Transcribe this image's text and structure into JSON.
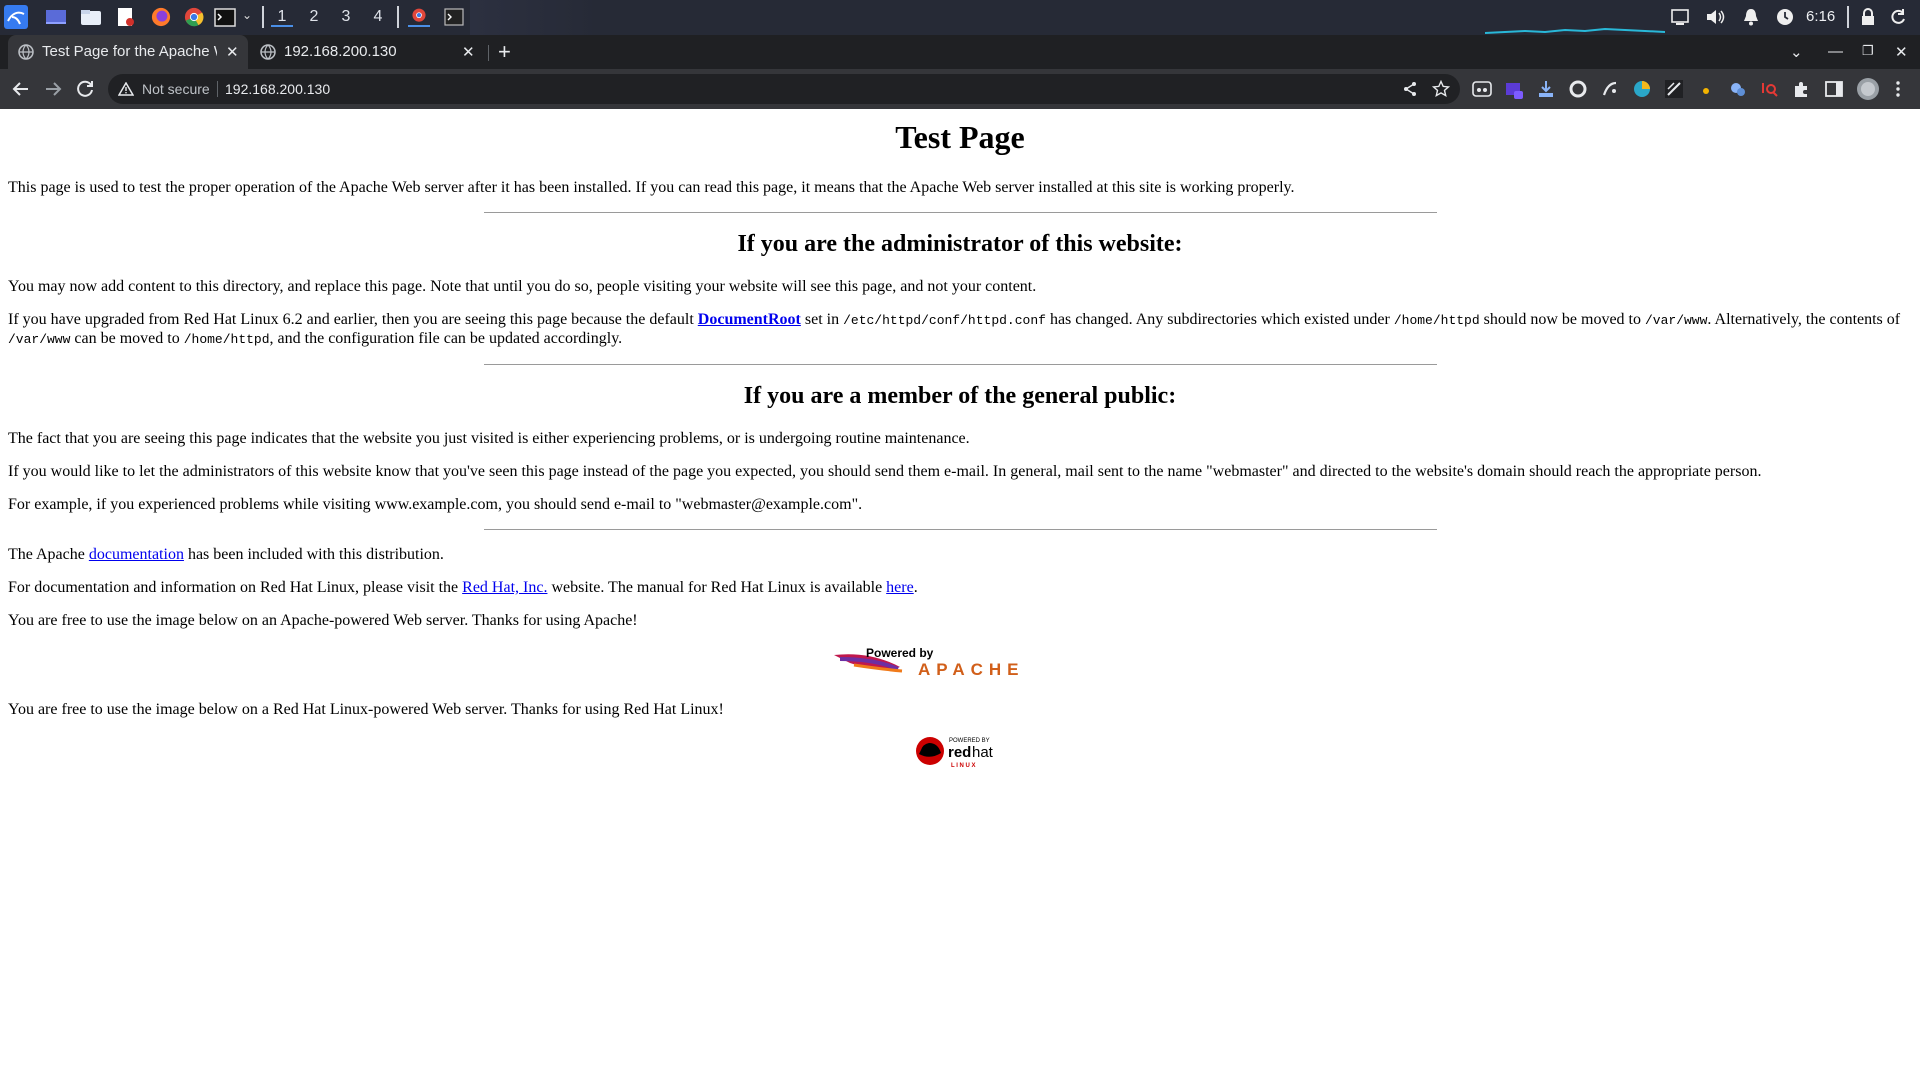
{
  "os_panel": {
    "workspaces": [
      "1",
      "2",
      "3",
      "4"
    ],
    "time": "6:16",
    "launchers": [
      "kali-menu-icon",
      "desktop-icon",
      "file-manager-icon",
      "text-editor-icon",
      "firefox-icon",
      "chrome-icon",
      "terminal-icon"
    ]
  },
  "browser": {
    "tabs": [
      {
        "title": "Test Page for the Apache W",
        "active": true
      },
      {
        "title": "192.168.200.130",
        "active": false
      }
    ],
    "omnibox": {
      "security_label": "Not secure",
      "url": "192.168.200.130"
    }
  },
  "page": {
    "title": "Test Page",
    "intro": "This page is used to test the proper operation of the Apache Web server after it has been installed. If you can read this page, it means that the Apache Web server installed at this site is working properly.",
    "admin_heading": "If you are the administrator of this website:",
    "admin_p1": "You may now add content to this directory, and replace this page. Note that until you do so, people visiting your website will see this page, and not your content.",
    "admin_p2": {
      "t1": "If you have upgraded from Red Hat Linux 6.2 and earlier, then you are seeing this page because the default ",
      "link_documentroot": "DocumentRoot",
      "t2": " set in ",
      "code_httpd_conf": "/etc/httpd/conf/httpd.conf",
      "t3": " has changed. Any subdirectories which existed under ",
      "code_home_httpd": "/home/httpd",
      "t4": " should now be moved to ",
      "code_var_www": "/var/www",
      "t5": ". Alternatively, the contents of ",
      "code_var_www_2": "/var/www",
      "t6": " can be moved to ",
      "code_home_httpd_2": "/home/httpd",
      "t7": ", and the configuration file can be updated accordingly."
    },
    "public_heading": "If you are a member of the general public:",
    "public_p1": "The fact that you are seeing this page indicates that the website you just visited is either experiencing problems, or is undergoing routine maintenance.",
    "public_p2": "If you would like to let the administrators of this website know that you've seen this page instead of the page you expected, you should send them e-mail. In general, mail sent to the name \"webmaster\" and directed to the website's domain should reach the appropriate person.",
    "public_p3": "For example, if you experienced problems while visiting www.example.com, you should send e-mail to \"webmaster@example.com\".",
    "apache_doc": {
      "t1": "The Apache ",
      "link": "documentation",
      "t2": " has been included with this distribution."
    },
    "redhat_doc": {
      "t1": "For documentation and information on Red Hat Linux, please visit the ",
      "link_redhat": "Red Hat, Inc.",
      "t2": " website. The manual for Red Hat Linux is available ",
      "link_here": "here",
      "t3": "."
    },
    "apache_img_note": "You are free to use the image below on an Apache-powered Web server. Thanks for using Apache!",
    "apache_badge": {
      "powered_by": "Powered by",
      "name": "APACHE"
    },
    "redhat_img_note": "You are free to use the image below on a Red Hat Linux-powered Web server. Thanks for using Red Hat Linux!",
    "redhat_badge": {
      "powered_by": "POWERED BY",
      "brand_red": "red",
      "brand_hat": "hat",
      "linux": "L I N U X"
    }
  },
  "colors": {
    "panel_bg": "#262a36",
    "tabstrip_bg": "#1f2023",
    "toolbar_bg": "#35363a",
    "link": "#0000ee"
  }
}
